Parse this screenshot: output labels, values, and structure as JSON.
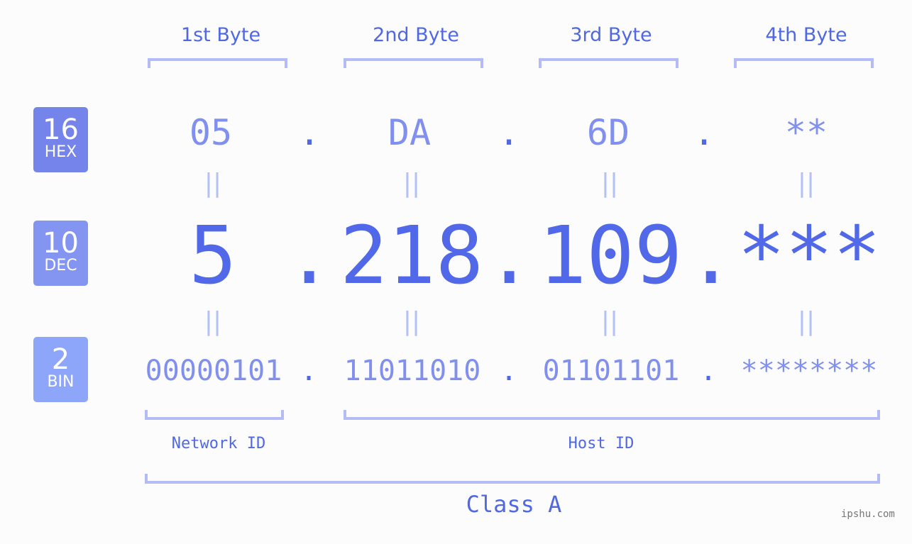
{
  "bytes": [
    {
      "label": "1st Byte",
      "hex": "05",
      "dec": "5",
      "bin": "00000101"
    },
    {
      "label": "2nd Byte",
      "hex": "DA",
      "dec": "218",
      "bin": "11011010"
    },
    {
      "label": "3rd Byte",
      "hex": "6D",
      "dec": "109",
      "bin": "01101101"
    },
    {
      "label": "4th Byte",
      "hex": "**",
      "dec": "***",
      "bin": "********"
    }
  ],
  "badges": {
    "hex": {
      "base": "16",
      "name": "HEX",
      "color": "#7584ea"
    },
    "dec": {
      "base": "10",
      "name": "DEC",
      "color": "#8394f1"
    },
    "bin": {
      "base": "2",
      "name": "BIN",
      "color": "#8ea6f9"
    }
  },
  "separator": ".",
  "equals": "||",
  "network_id_label": "Network ID",
  "host_id_label": "Host ID",
  "class_label": "Class A",
  "watermark": "ipshu.com"
}
